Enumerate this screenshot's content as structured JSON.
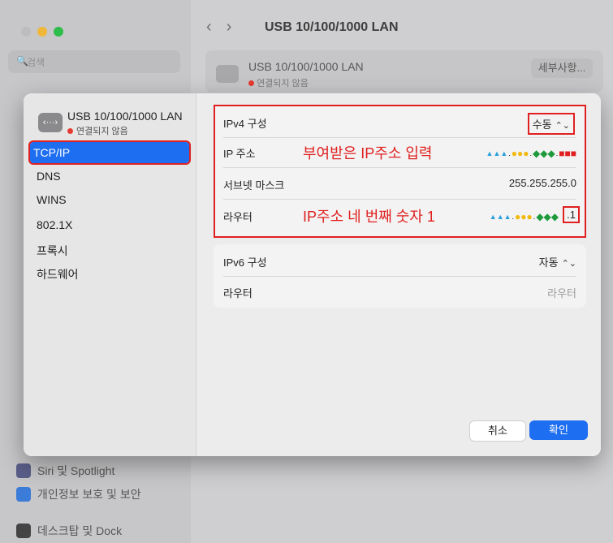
{
  "background": {
    "title": "USB 10/100/1000 LAN",
    "search_placeholder": "검색",
    "card": {
      "name": "USB 10/100/1000 LAN",
      "status": "연결되지 않음",
      "details_button": "세부사항..."
    },
    "sidebar_items": [
      {
        "label": "Siri 및 Spotlight",
        "icon_color": "#5a5f8a"
      },
      {
        "label": "개인정보 보호 및 보안",
        "icon_color": "#3b7cd8"
      },
      {
        "label": "데스크탑 및 Dock",
        "icon_color": "#444444"
      }
    ]
  },
  "sheet": {
    "interface": {
      "name": "USB 10/100/1000 LAN",
      "status": "연결되지 않음",
      "icon": "network-interface-icon"
    },
    "tabs": [
      {
        "label": "TCP/IP"
      },
      {
        "label": "DNS"
      },
      {
        "label": "WINS"
      },
      {
        "label": "802.1X"
      },
      {
        "label": "프록시"
      },
      {
        "label": "하드웨어"
      }
    ],
    "ipv4": {
      "config_label": "IPv4 구성",
      "config_value": "수동",
      "ip_label": "IP 주소",
      "subnet_label": "서브넷 마스크",
      "subnet_value": "255.255.255.0",
      "router_label": "라우터",
      "router_suffix": ".1"
    },
    "annotations": {
      "ip": "부여받은 IP주소 입력",
      "router": "IP주소 네 번째 숫자 1"
    },
    "ipv6": {
      "config_label": "IPv6 구성",
      "config_value": "자동",
      "router_label": "라우터",
      "router_placeholder": "라우터"
    },
    "buttons": {
      "cancel": "취소",
      "ok": "확인"
    }
  },
  "colors": {
    "accent": "#1e6ef1",
    "annotation_red": "#e02020",
    "disconnected_dot": "#e53a2f"
  }
}
